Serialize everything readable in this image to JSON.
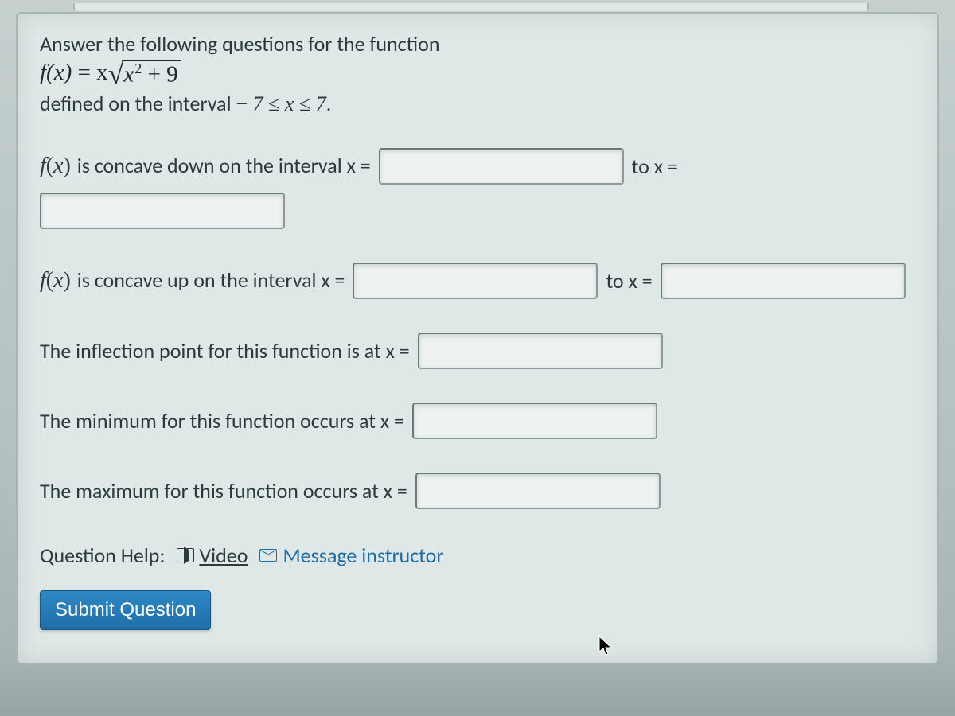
{
  "intro": "Answer the following questions for the function",
  "formula": {
    "fx": "f(x)",
    "equals_x": " = x",
    "radicand_x": "x",
    "radicand_sup": "2",
    "radicand_plus": " + 9"
  },
  "interval_prefix": "defined on the interval ",
  "interval_math": "− 7 ≤ x ≤ 7.",
  "rows": {
    "concave_down": {
      "fx": "f(x)",
      "text": " is concave down on the interval x = ",
      "to": "to x =",
      "val1": "",
      "val2": ""
    },
    "concave_up": {
      "fx": "f(x)",
      "text": " is concave up on the interval x = ",
      "to": "to x =",
      "val1": "",
      "val2": ""
    },
    "inflection": {
      "text": "The inflection point for this function is at x = ",
      "val": ""
    },
    "minimum": {
      "text": "The minimum for this function occurs at x = ",
      "val": ""
    },
    "maximum": {
      "text": "The maximum for this function occurs at x = ",
      "val": ""
    }
  },
  "help": {
    "label": "Question Help:",
    "video": "Video",
    "message": "Message instructor"
  },
  "submit": "Submit Question"
}
